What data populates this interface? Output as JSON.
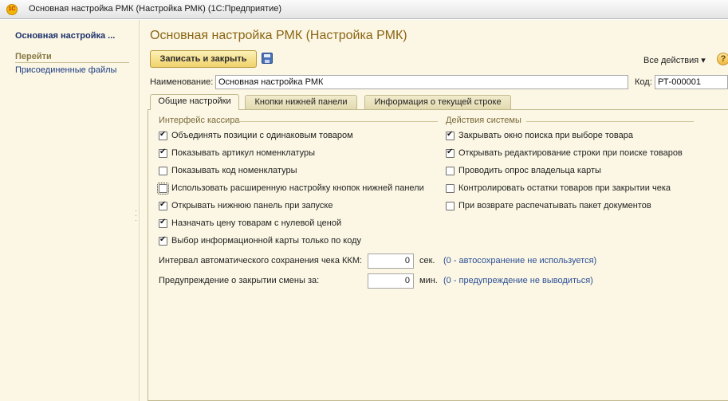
{
  "window": {
    "title": "Основная настройка РМК (Настройка РМК)  (1С:Предприятие)",
    "logo_text": "1С"
  },
  "left_panel": {
    "form_title": "Основная настройка ...",
    "nav_header": "Перейти",
    "links": [
      "Присоединенные файлы"
    ]
  },
  "form": {
    "header": "Основная настройка РМК (Настройка РМК)",
    "save_close_label": "Записать и закрыть",
    "all_actions_label": "Все действия ▾",
    "help_label": "?",
    "name_label": "Наименование:",
    "name_value": "Основная настройка РМК",
    "code_label": "Код:",
    "code_value": "РТ-000001"
  },
  "tabs": [
    {
      "label": "Общие настройки",
      "active": true
    },
    {
      "label": "Кнопки нижней панели",
      "active": false
    },
    {
      "label": "Информация о текущей строке",
      "active": false
    }
  ],
  "cashier_group": {
    "title": "Интерфейс кассира",
    "items": [
      {
        "label": "Объединять позиции с одинаковым товаром",
        "checked": true
      },
      {
        "label": "Показывать артикул номенклатуры",
        "checked": true
      },
      {
        "label": "Показывать код номенклатуры",
        "checked": false
      },
      {
        "label": "Использовать расширенную настройку кнопок нижней панели",
        "checked": false
      },
      {
        "label": "Открывать нижнюю панель при запуске",
        "checked": true
      },
      {
        "label": "Назначать цену товарам с нулевой ценой",
        "checked": true
      },
      {
        "label": "Выбор информационной карты только по коду",
        "checked": true
      }
    ]
  },
  "system_group": {
    "title": "Действия системы",
    "items": [
      {
        "label": "Закрывать окно поиска при выборе товара",
        "checked": true
      },
      {
        "label": "Открывать редактирование строки при поиске товаров",
        "checked": true
      },
      {
        "label": "Проводить опрос владельца карты",
        "checked": false
      },
      {
        "label": "Контролировать остатки товаров при закрытии чека",
        "checked": false
      },
      {
        "label": "При возврате распечатывать пакет документов",
        "checked": false
      }
    ]
  },
  "intervals": {
    "autosave_label": "Интервал автоматического сохранения чека ККМ:",
    "autosave_value": "0",
    "autosave_unit": "сек.",
    "autosave_hint": "(0 - автосохранение не используется)",
    "warning_label": "Предупреждение о закрытии смены за:",
    "warning_value": "0",
    "warning_unit": "мин.",
    "warning_hint": "(0 - предупреждение не выводиться)"
  }
}
